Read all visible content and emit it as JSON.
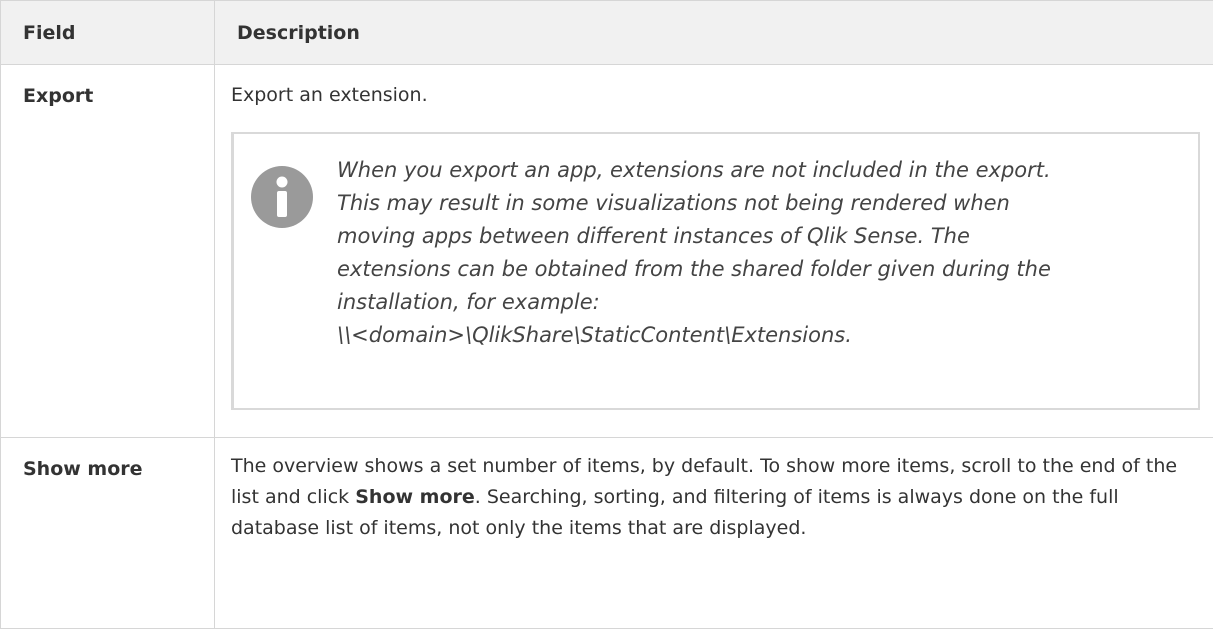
{
  "table": {
    "headers": {
      "field": "Field",
      "description": "Description"
    },
    "rows": [
      {
        "field": "Export",
        "description": "Export an extension.",
        "note": {
          "icon": "info-icon",
          "lines": [
            "When you export an app, extensions are not included in the export.",
            "This may result in some visualizations not being rendered when",
            "moving apps between different instances of Qlik Sense. The",
            "extensions can be obtained from the shared folder given during the",
            "installation, for example:",
            "\\\\<domain>\\QlikShare\\StaticContent\\Extensions."
          ]
        }
      },
      {
        "field": "Show more",
        "description_parts": {
          "before": "The overview shows a set number of items, by default. To show more items, scroll to the end of the list and click ",
          "bold": "Show more",
          "after": ". Searching, sorting, and filtering of items is always done on the full database list of items, not only the items that are displayed."
        }
      }
    ]
  },
  "colors": {
    "header_bg": "#f1f1f1",
    "border": "#d6d6d6",
    "note_border": "#d9d9d9",
    "icon_fill": "#9a9a9a",
    "text": "#333333"
  }
}
